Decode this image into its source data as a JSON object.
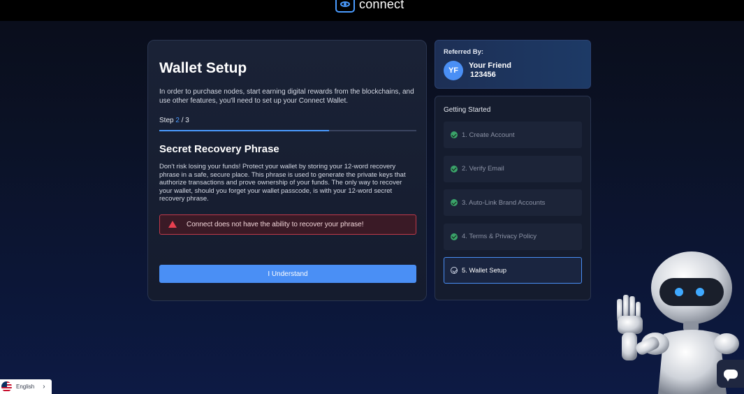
{
  "brand": {
    "name": "connect"
  },
  "wallet": {
    "title": "Wallet Setup",
    "intro": "In order to purchase nodes, start earning digital rewards from the blockchains, and use other features, you'll need to set up your Connect Wallet.",
    "step_prefix": "Step",
    "step_current": "2",
    "step_total": "/ 3",
    "progress_fraction": 0.66,
    "subtitle": "Secret Recovery Phrase",
    "body": "Don't risk losing your funds! Protect your wallet by storing your 12-word recovery phrase in a safe, secure place. This phrase is used to generate the private keys that authorize transactions and prove ownership of your funds. The only way to recover your wallet, should you forget your wallet passcode, is with your 12-word secret recovery phrase.",
    "warning": "Connect does not have the ability to recover your phrase!",
    "button_label": "I Understand"
  },
  "referral": {
    "label": "Referred By:",
    "initials": "YF",
    "name": "Your Friend",
    "code": "123456"
  },
  "getting_started": {
    "title": "Getting Started",
    "steps": [
      {
        "label": "1. Create Account",
        "done": true
      },
      {
        "label": "2. Verify Email",
        "done": true
      },
      {
        "label": "3. Auto-Link Brand Accounts",
        "done": true
      },
      {
        "label": "4. Terms & Privacy Policy",
        "done": true
      },
      {
        "label": "5. Wallet Setup",
        "done": false,
        "active": true
      }
    ]
  },
  "language": {
    "label": "English"
  },
  "colors": {
    "accent": "#4a8ff5",
    "success": "#3aa36a",
    "danger": "#e8404f"
  }
}
